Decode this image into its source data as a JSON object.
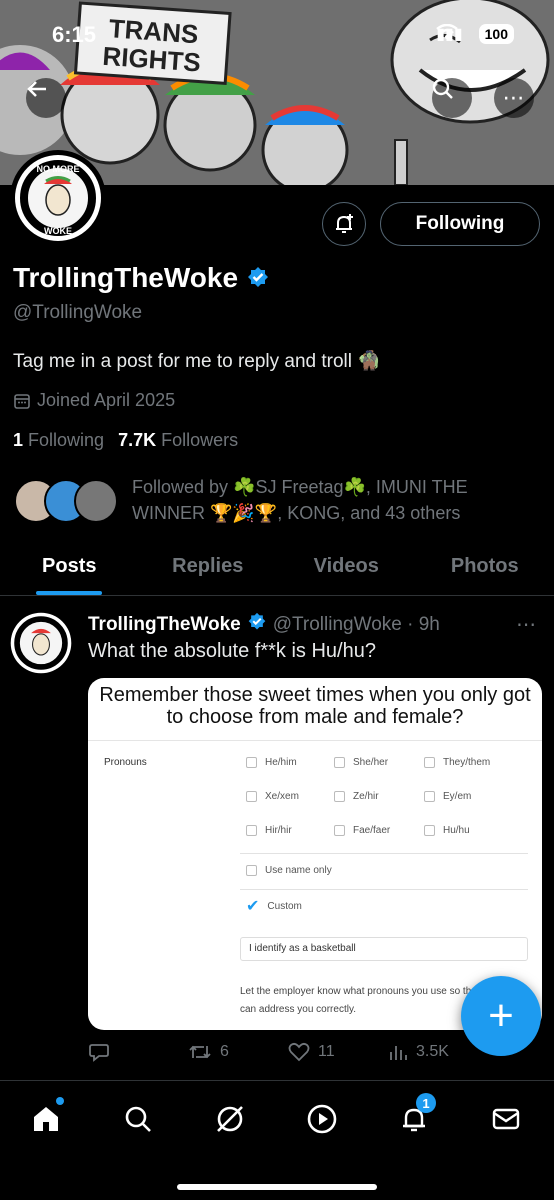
{
  "status_bar": {
    "time": "6:15",
    "battery": "100"
  },
  "banner": {
    "sign_line1": "TRANS",
    "sign_line2": "RIGHTS"
  },
  "avatar": {
    "text_top": "NO MORE",
    "text_bottom": "WOKE"
  },
  "profile": {
    "display_name": "TrollingTheWoke",
    "handle": "@TrollingWoke",
    "bio": "Tag me in a post for me to reply and troll 🧌",
    "joined": "Joined April 2025",
    "following_count": "1",
    "following_label": "Following",
    "followers_count": "7.7K",
    "followers_label": "Followers",
    "followed_by": "Followed by ☘️SJ Freetag☘️, IMUNI THE WINNER 🏆🎉🏆, KONG, and 43 others",
    "follow_button": "Following"
  },
  "tabs": [
    "Posts",
    "Replies",
    "Videos",
    "Photos"
  ],
  "post": {
    "author": "TrollingTheWoke",
    "meta": "@TrollingWoke · 9h",
    "text": "What the absolute f**k is Hu/hu?",
    "image": {
      "caption": "Remember those sweet times when you only got to choose from male and female?",
      "field_label": "Pronouns",
      "options": [
        "He/him",
        "She/her",
        "They/them",
        "Xe/xem",
        "Ze/hir",
        "Ey/em",
        "Hir/hir",
        "Fae/faer",
        "Hu/hu"
      ],
      "name_only": "Use name only",
      "custom": "Custom",
      "custom_value": "I identify as a basketball",
      "help_text": "Let the employer know what pronouns you use so that they can address you correctly."
    },
    "replies": "",
    "reposts": "6",
    "likes": "11",
    "views": "3.5K"
  },
  "nav": {
    "notifications_badge": "1"
  },
  "colors": {
    "accent": "#1d9bf0",
    "muted": "#71767b",
    "background": "#000000"
  }
}
